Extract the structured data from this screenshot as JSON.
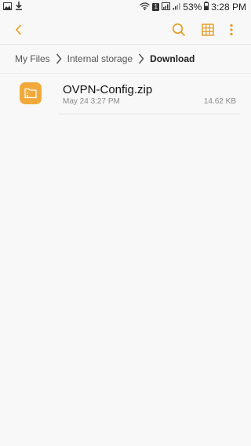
{
  "status_bar": {
    "battery": "53%",
    "time": "3:28 PM",
    "sim": "1",
    "icons": [
      "image-icon",
      "download-icon",
      "wifi-icon",
      "signal-icon",
      "battery-icon"
    ]
  },
  "toolbar": {
    "icons": [
      "back-icon",
      "search-icon",
      "grid-view-icon",
      "more-icon"
    ],
    "accent_color": "#e59a19"
  },
  "breadcrumb": {
    "items": [
      "My Files",
      "Internal storage",
      "Download"
    ]
  },
  "files": [
    {
      "name": "OVPN-Config.zip",
      "date": "May 24 3:27 PM",
      "size": "14.62 KB",
      "icon": "zip-folder-icon",
      "icon_color": "#f2a93b"
    }
  ]
}
